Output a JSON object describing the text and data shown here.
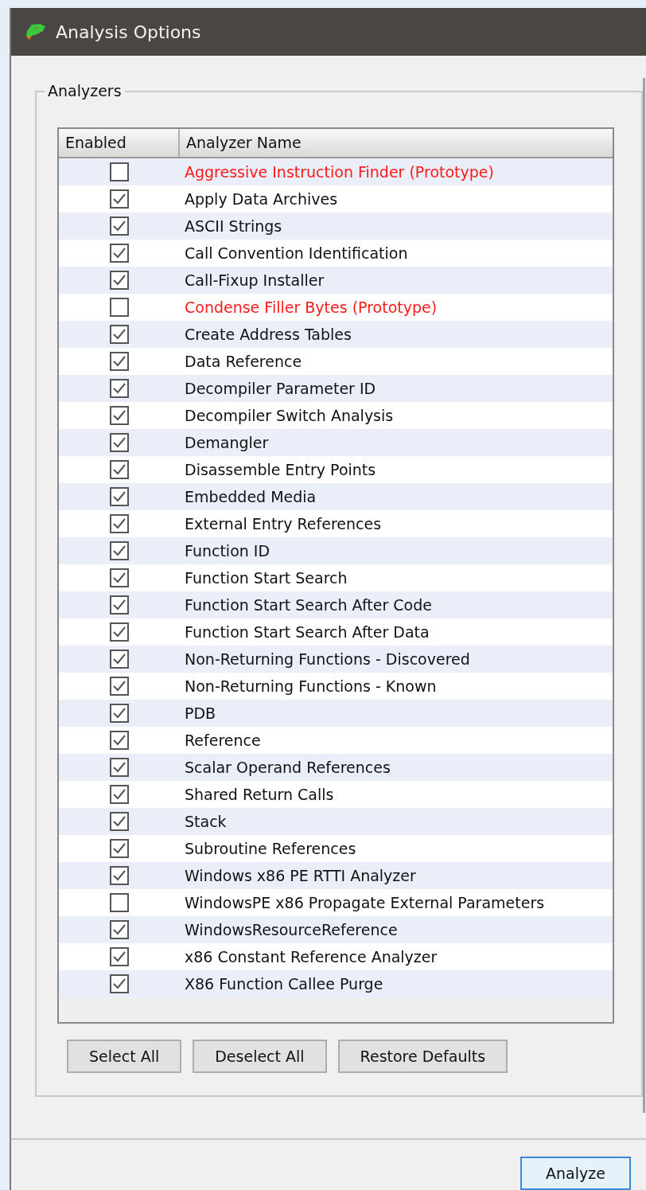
{
  "window": {
    "title": "Analysis Options"
  },
  "analyzers": {
    "label": "Analyzers",
    "columns": [
      "Enabled",
      "Analyzer Name"
    ],
    "rows": [
      {
        "name": "Aggressive Instruction Finder (Prototype)",
        "checked": false,
        "prototype": true
      },
      {
        "name": "Apply Data Archives",
        "checked": true,
        "prototype": false
      },
      {
        "name": "ASCII Strings",
        "checked": true,
        "prototype": false
      },
      {
        "name": "Call Convention Identification",
        "checked": true,
        "prototype": false
      },
      {
        "name": "Call-Fixup Installer",
        "checked": true,
        "prototype": false
      },
      {
        "name": "Condense Filler Bytes (Prototype)",
        "checked": false,
        "prototype": true
      },
      {
        "name": "Create Address Tables",
        "checked": true,
        "prototype": false
      },
      {
        "name": "Data Reference",
        "checked": true,
        "prototype": false
      },
      {
        "name": "Decompiler Parameter ID",
        "checked": true,
        "prototype": false
      },
      {
        "name": "Decompiler Switch Analysis",
        "checked": true,
        "prototype": false
      },
      {
        "name": "Demangler",
        "checked": true,
        "prototype": false
      },
      {
        "name": "Disassemble Entry Points",
        "checked": true,
        "prototype": false
      },
      {
        "name": "Embedded Media",
        "checked": true,
        "prototype": false
      },
      {
        "name": "External Entry References",
        "checked": true,
        "prototype": false
      },
      {
        "name": "Function ID",
        "checked": true,
        "prototype": false
      },
      {
        "name": "Function Start Search",
        "checked": true,
        "prototype": false
      },
      {
        "name": "Function Start Search After Code",
        "checked": true,
        "prototype": false
      },
      {
        "name": "Function Start Search After Data",
        "checked": true,
        "prototype": false
      },
      {
        "name": "Non-Returning Functions - Discovered",
        "checked": true,
        "prototype": false
      },
      {
        "name": "Non-Returning Functions - Known",
        "checked": true,
        "prototype": false
      },
      {
        "name": "PDB",
        "checked": true,
        "prototype": false
      },
      {
        "name": "Reference",
        "checked": true,
        "prototype": false
      },
      {
        "name": "Scalar Operand References",
        "checked": true,
        "prototype": false
      },
      {
        "name": "Shared Return Calls",
        "checked": true,
        "prototype": false
      },
      {
        "name": "Stack",
        "checked": true,
        "prototype": false
      },
      {
        "name": "Subroutine References",
        "checked": true,
        "prototype": false
      },
      {
        "name": "Windows x86 PE RTTI Analyzer",
        "checked": true,
        "prototype": false
      },
      {
        "name": "WindowsPE x86 Propagate External Parameters",
        "checked": false,
        "prototype": false
      },
      {
        "name": "WindowsResourceReference",
        "checked": true,
        "prototype": false
      },
      {
        "name": "x86 Constant Reference Analyzer",
        "checked": true,
        "prototype": false
      },
      {
        "name": "X86 Function Callee Purge",
        "checked": true,
        "prototype": false
      }
    ],
    "buttons": [
      "Select All",
      "Deselect All",
      "Restore Defaults"
    ]
  },
  "footer_buttons": [
    {
      "label": "Analyze",
      "default": true
    }
  ]
}
